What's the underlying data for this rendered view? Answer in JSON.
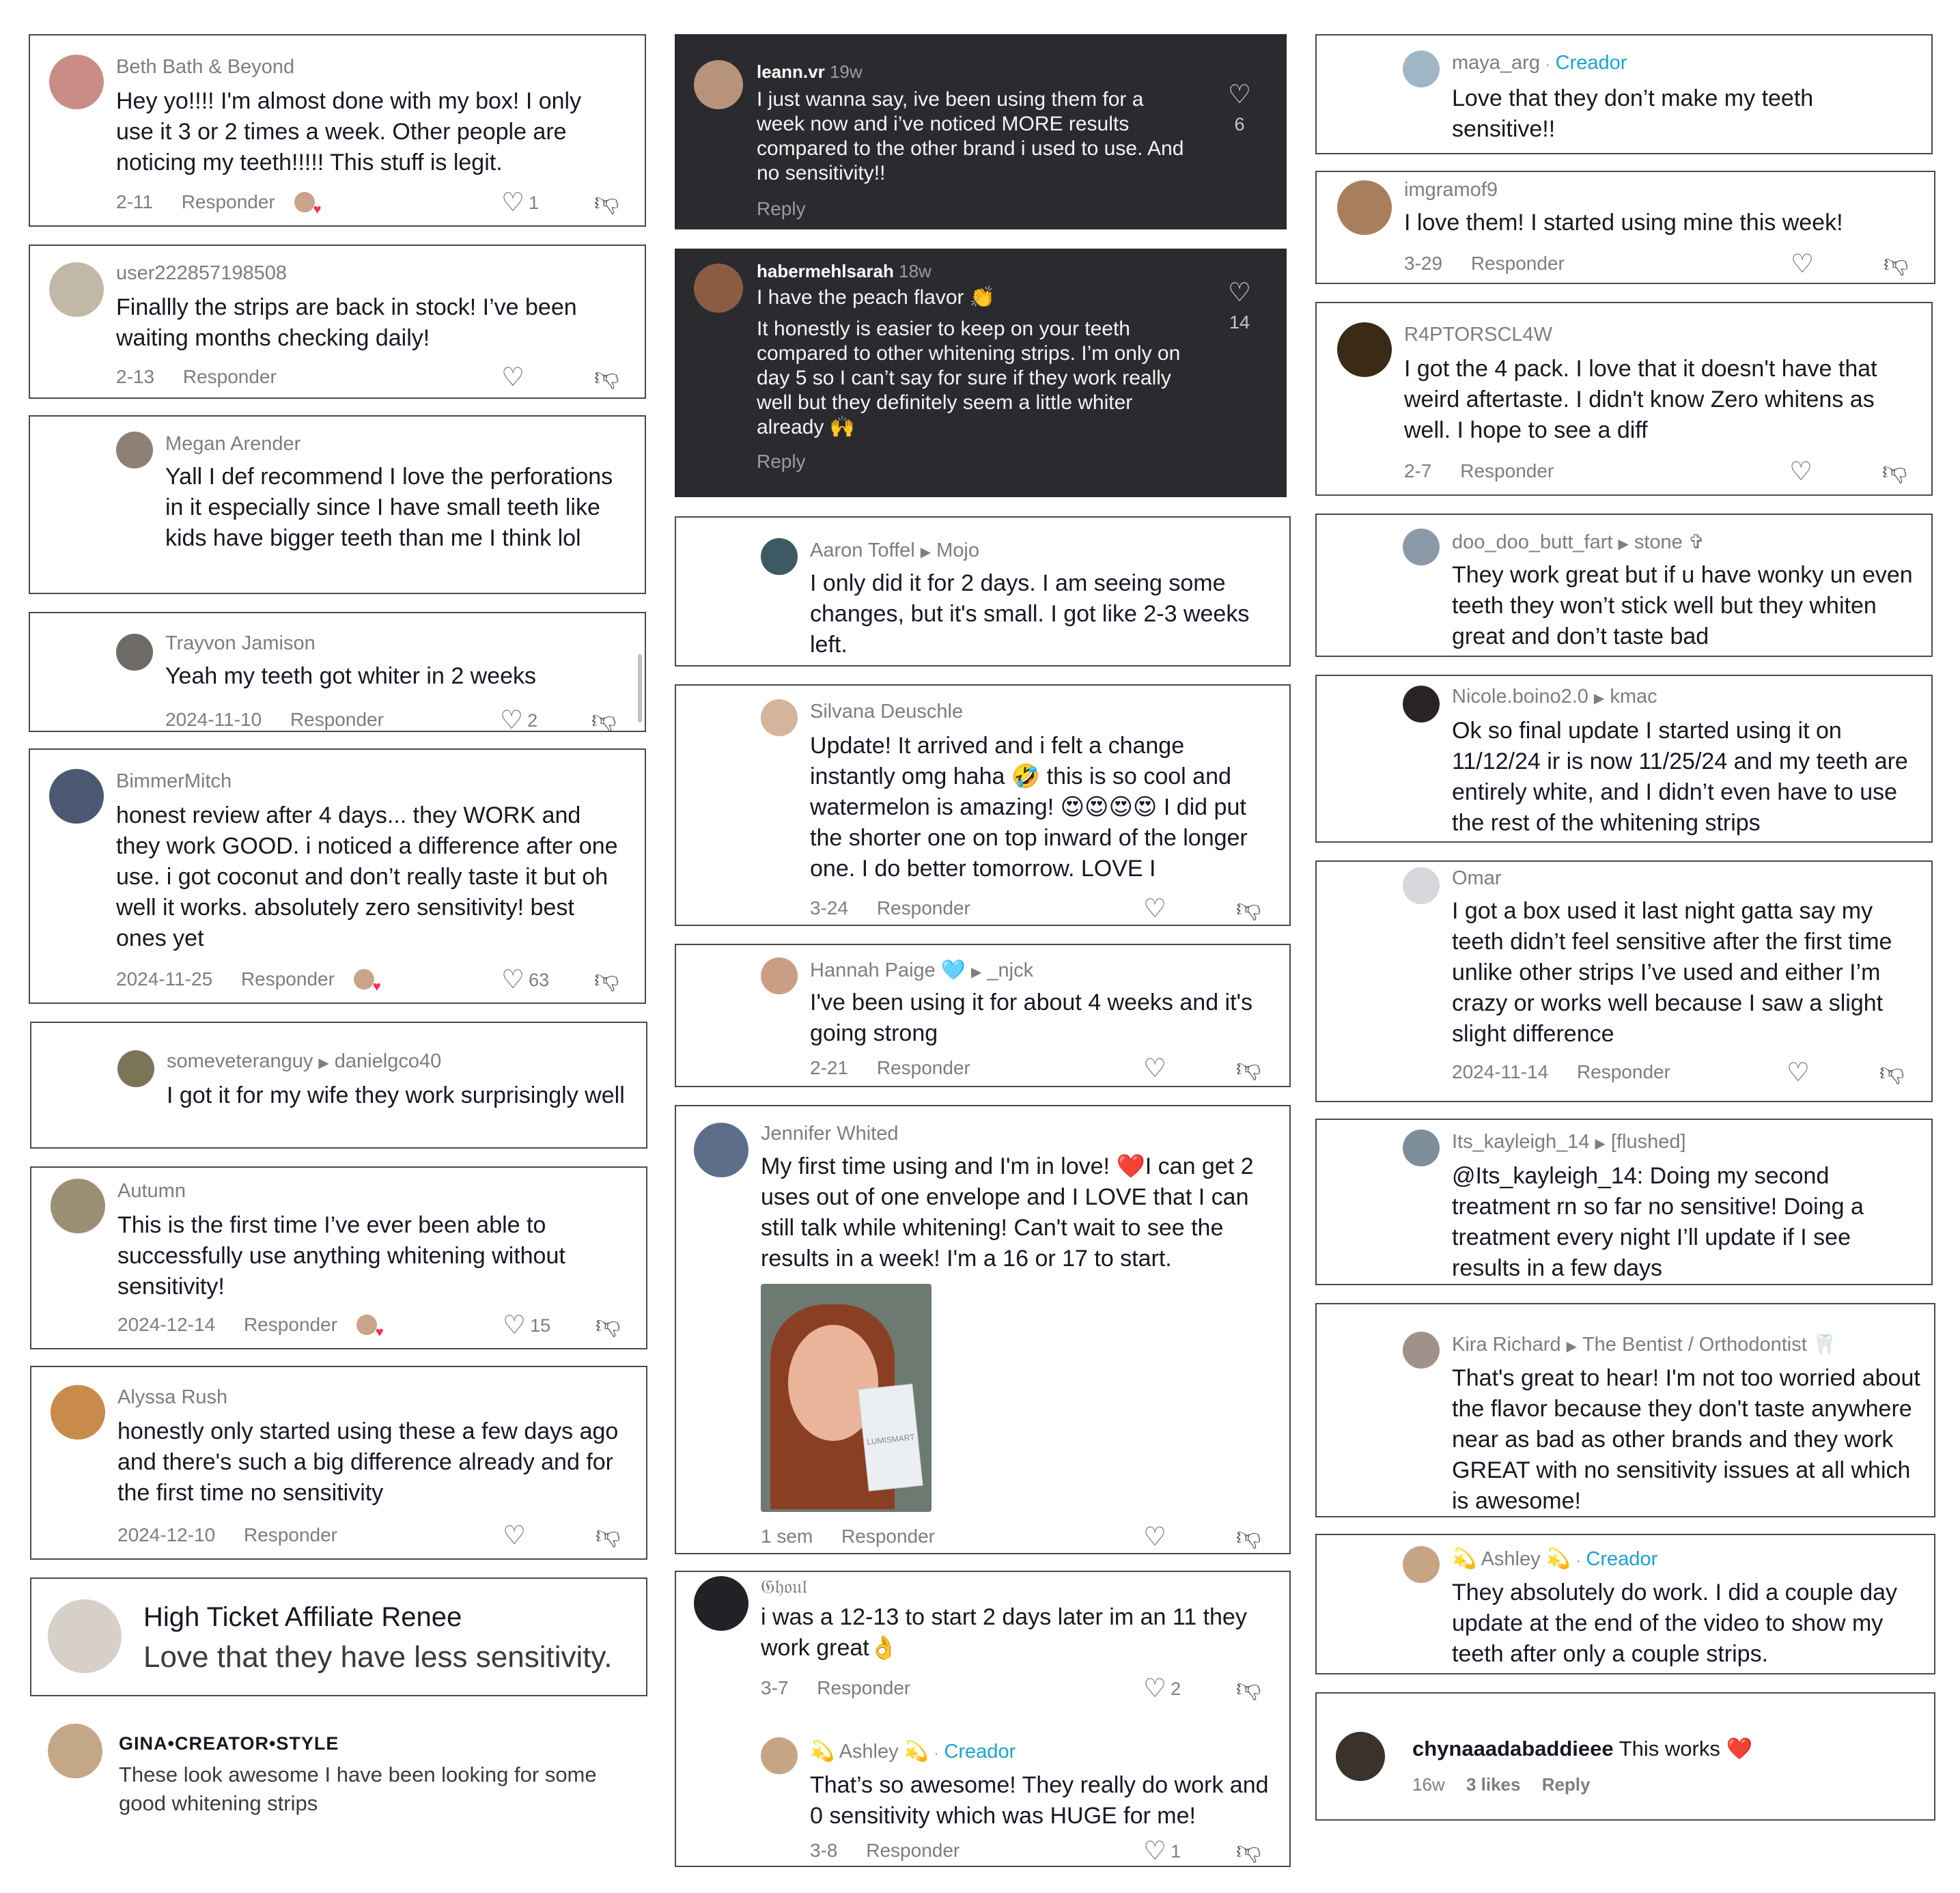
{
  "comments": {
    "c1": {
      "name": "Beth Bath & Beyond",
      "text": "Hey yo!!!! I'm almost done with my box! I only use it 3 or 2 times a week. Other people are noticing my teeth!!!!! This stuff is legit.",
      "date": "2-11",
      "reply": "Responder",
      "likes": "1",
      "creator_badge": "SM"
    },
    "c2": {
      "name": "user222857198508",
      "text": "Finallly the strips are back in stock! I’ve been waiting months checking daily!",
      "date": "2-13",
      "reply": "Responder"
    },
    "c3": {
      "name": "Megan Arender",
      "text": "Yall I def recommend I love the perforations in it especially since I have small teeth like kids have bigger teeth than me I think lol"
    },
    "c4": {
      "name": "Trayvon Jamison",
      "text": "Yeah my teeth got whiter in 2 weeks",
      "date": "2024-11-10",
      "reply": "Responder",
      "likes": "2"
    },
    "c5": {
      "name": "BimmerMitch",
      "text": "honest review after 4 days... they WORK and they work GOOD. i noticed a difference after one use. i got coconut and don’t really taste it but oh well it works. absolutely zero sensitivity! best ones yet",
      "date": "2024-11-25",
      "reply": "Responder",
      "likes": "63"
    },
    "c6": {
      "name": "someveteranguy",
      "reply_to": "danielgco40",
      "text": "I got it for my wife they work surprisingly well"
    },
    "c7": {
      "name": "Autumn",
      "text": "This is the first time I’ve ever been able to successfully use anything whitening without sensitivity!",
      "date": "2024-12-14",
      "reply": "Responder",
      "likes": "15"
    },
    "c8": {
      "name": "Alyssa Rush",
      "text": "honestly only started using these a few days ago and there's such a big difference already and for the first time no sensitivity",
      "date": "2024-12-10",
      "reply": "Responder"
    },
    "c9": {
      "name": "High Ticket Affiliate Renee",
      "text": "Love that they have less sensitivity."
    },
    "c10": {
      "name": "GINA•CREATOR•STYLE",
      "text": "These look awesome I have been looking for some good whitening strips"
    },
    "c11": {
      "name": "leann.vr",
      "time": "19w",
      "text": "I just wanna say, ive been using them for a week now and i’ve noticed MORE results compared to the other brand i used to use. And no sensitivity!!",
      "reply": "Reply",
      "likes": "6"
    },
    "c12": {
      "name": "habermehlsarah",
      "time": "18w",
      "text1": "I have the peach flavor 👏",
      "text2": "It honestly is easier to keep on your teeth compared to other whitening strips. I’m only on day 5 so I can’t say for sure if they work really well but they definitely seem a little whiter already 🙌",
      "reply": "Reply",
      "likes": "14"
    },
    "c13": {
      "name": "Aaron Toffel",
      "reply_to": "Mojo",
      "text": "I only did it for 2 days. I am seeing some changes, but it's small. I got like 2-3 weeks left."
    },
    "c14": {
      "name": "Silvana Deuschle",
      "text": "Update! It arrived and i felt a change instantly omg haha 🤣 this is so cool and watermelon is amazing! 😍😍😍😍 I did put the shorter one on top inward of the longer one. I do better tomorrow. LOVE I",
      "date": "3-24",
      "reply": "Responder"
    },
    "c15": {
      "name": "Hannah Paige 🩵",
      "reply_to": "_njck",
      "text": "I've been using it for about 4 weeks and it's going strong",
      "date": "2-21",
      "reply": "Responder"
    },
    "c16": {
      "name": "Jennifer Whited",
      "text": "My first time using and I'm in love! ❤️I can get 2 uses out of one envelope and I LOVE that I can still talk while whitening! Can't wait to see the results in a week! I'm a 16 or 17 to start.",
      "date": "1 sem",
      "reply": "Responder",
      "box_label": "LUMISMART"
    },
    "c17": {
      "name": "𝔊𝔥𝔬𝔲𝔩",
      "text": "i was a 12-13 to start 2 days later im an 11 they work great👌",
      "date": "3-7",
      "reply": "Responder",
      "likes": "2"
    },
    "c17r": {
      "name": "💫 Ashley 💫",
      "tag": "Creador",
      "text": "That’s so awesome! They really do work and 0 sensitivity which was HUGE for me!",
      "date": "3-8",
      "reply": "Responder",
      "likes": "1"
    },
    "c18": {
      "name": "maya_arg",
      "tag": "Creador",
      "text": "Love that they don’t make my teeth sensitive!!"
    },
    "c19": {
      "name": "imgramof9",
      "text": "I love them! I started using mine this week!",
      "date": "3-29",
      "reply": "Responder"
    },
    "c20": {
      "name": "R4PTORSCL4W",
      "text": "I got the 4 pack. I love that it doesn't have that weird aftertaste. I didn't know Zero whitens as well. I hope to see a diff",
      "date": "2-7",
      "reply": "Responder"
    },
    "c21": {
      "name": "doo_doo_butt_fart",
      "reply_to": "stone ✞",
      "text": "They work great but if u have wonky un even teeth they won’t stick well but they whiten great and don’t taste bad"
    },
    "c22": {
      "name": "Nicole.boino2.0",
      "reply_to": "kmac",
      "text": "Ok so final update I started using it on 11/12/24 ir is now 11/25/24 and my teeth are entirely white, and I didn’t even have to use the rest of the whitening strips"
    },
    "c23": {
      "name": "Omar",
      "text": "I got a box used it last night gatta say my teeth didn’t feel sensitive after the first time unlike other strips I’ve used and either I’m crazy or works well because I saw a slight slight difference",
      "date": "2024-11-14",
      "reply": "Responder"
    },
    "c24": {
      "name": "Its_kayleigh_14",
      "reply_to": "[flushed]",
      "text": "@Its_kayleigh_14: Doing my second treatment rn so far no sensitive! Doing a treatment every night I’ll update if I see results in a few days"
    },
    "c25": {
      "name": "Kira Richard",
      "reply_to": "The Bentist / Orthodontist 🦷",
      "text": "That's great to hear! I'm not too worried about the flavor because they don't taste anywhere near as bad as other brands and they work GREAT with no sensitivity issues at all which is awesome!"
    },
    "c26": {
      "name": "💫 Ashley 💫",
      "tag": "Creador",
      "text": "They absolutely do work. I did a couple day update at the end of the video to show my teeth after only a couple strips."
    },
    "c27": {
      "name": "chynaaadabaddieee",
      "text": "This works ❤️",
      "time": "16w",
      "likes_text": "3 likes",
      "reply": "Reply"
    }
  },
  "icons": {
    "heart": "heart-outline-icon",
    "dislike": "thumbs-down-icon",
    "reply_arrow": "caret-right-icon"
  },
  "colors": {
    "dark_card": "#2b2b2f",
    "creator_tag": "#1ba2d1",
    "muted": "#7d7d82",
    "like_red": "#fe2c55"
  }
}
